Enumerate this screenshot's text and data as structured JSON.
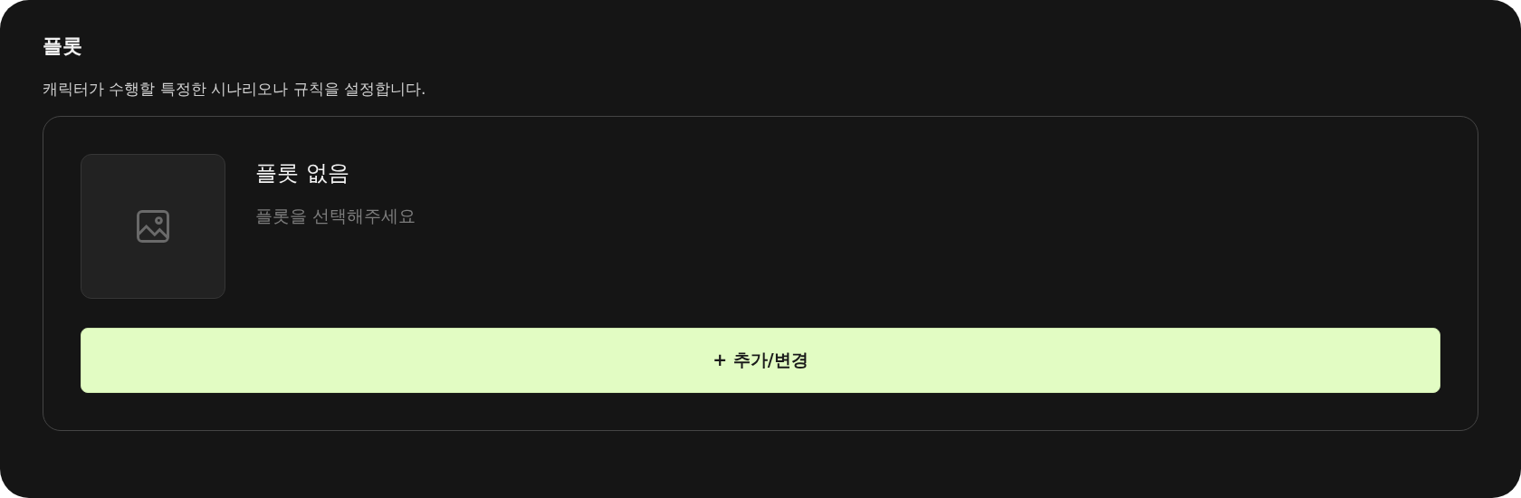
{
  "section": {
    "title": "플롯",
    "description": "캐릭터가 수행할 특정한 시나리오나 규칙을 설정합니다."
  },
  "plot_card": {
    "name": "플롯 없음",
    "hint": "플롯을 선택해주세요",
    "image": {
      "kind": "placeholder"
    },
    "button": "+ 추가/변경"
  }
}
